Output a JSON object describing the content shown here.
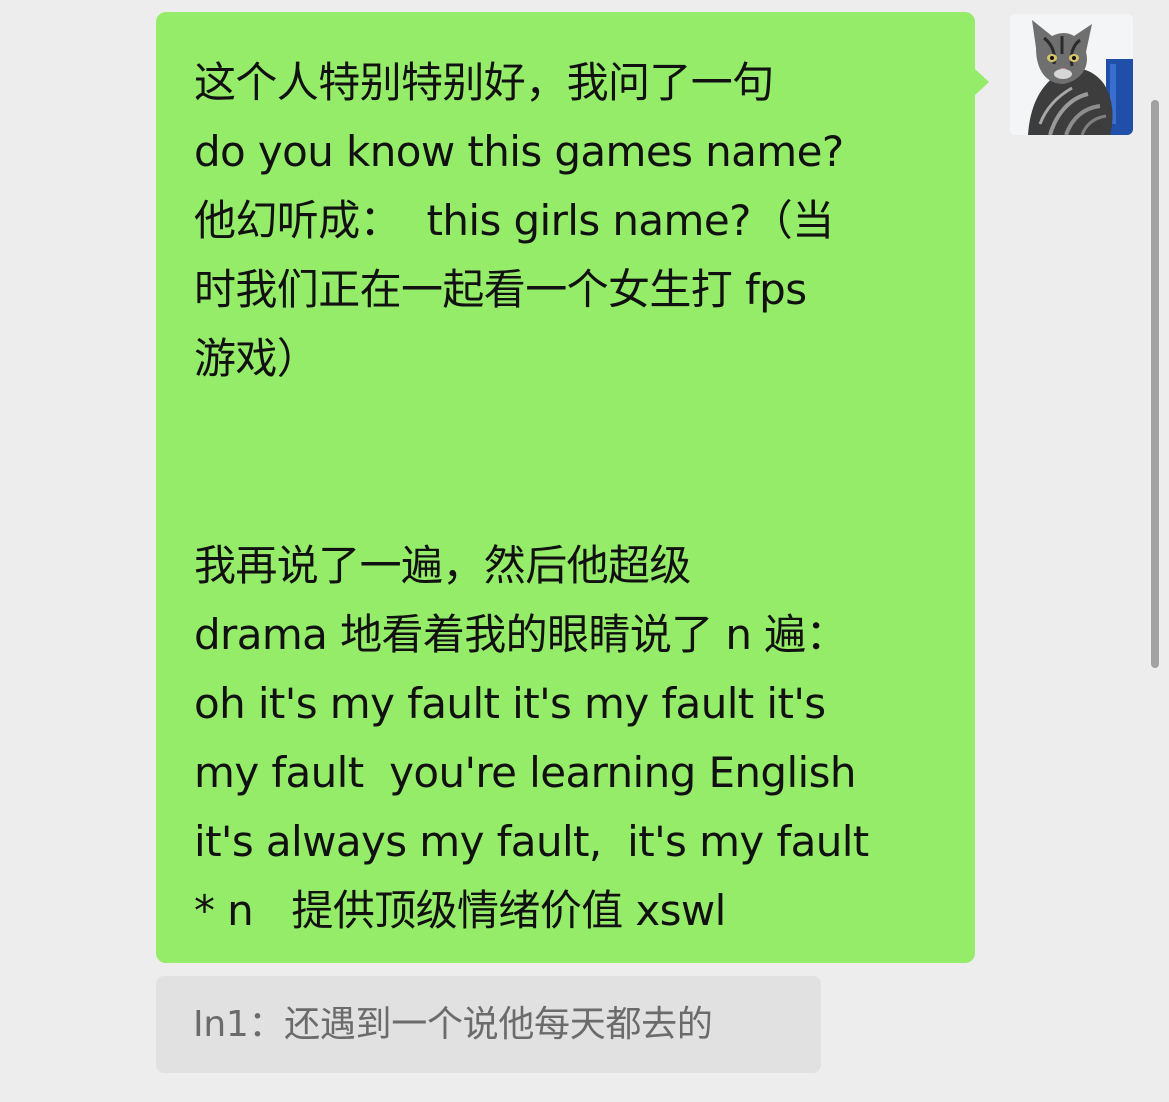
{
  "message": {
    "lines": [
      "这个人特别特别好，我问了一句",
      "do you know this games name?",
      "他幻听成：  this girls name?（当",
      "时我们正在一起看一个女生打 fps",
      "游戏）"
    ],
    "lines2": [
      "我再说了一遍，然后他超级",
      "drama 地看着我的眼睛说了 n 遍：",
      "oh it's my fault it's my fault it's",
      "my fault  you're learning English",
      "it's always my fault,  it's my fault",
      "* n   提供顶级情绪价值 xswl"
    ]
  },
  "quote": {
    "text": "In1：还遇到一个说他每天都去的"
  },
  "avatar": {
    "icon": "cat-avatar-icon"
  },
  "colors": {
    "background": "#ededed",
    "sent_bubble": "#95ec69",
    "quote_bubble": "#e1e1e1",
    "quote_text": "#6b6b6b",
    "scrollbar": "#a2a2a2"
  }
}
